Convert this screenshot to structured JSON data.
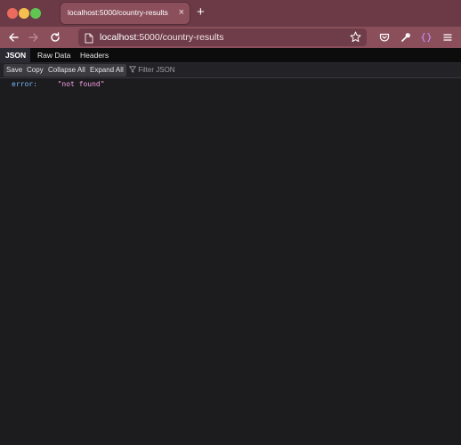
{
  "browser": {
    "tab_title": "localhost:5000/country-results",
    "tab_close_icon": "×",
    "new_tab_icon": "+",
    "url_host": "localhost",
    "url_rest": ":5000/country-results"
  },
  "viewer": {
    "tabs": [
      "JSON",
      "Raw Data",
      "Headers"
    ],
    "active_tab": "JSON",
    "toolbar_buttons": [
      "Save",
      "Copy",
      "Collapse All",
      "Expand All"
    ],
    "filter_placeholder": "Filter JSON"
  },
  "json": {
    "key": "error:",
    "value": "\"not found\""
  },
  "colors": {
    "tabstrip": "#6b3a46",
    "navbar": "#8b4f5c",
    "json_key": "#79b7ff",
    "json_string": "#f59fe7"
  }
}
